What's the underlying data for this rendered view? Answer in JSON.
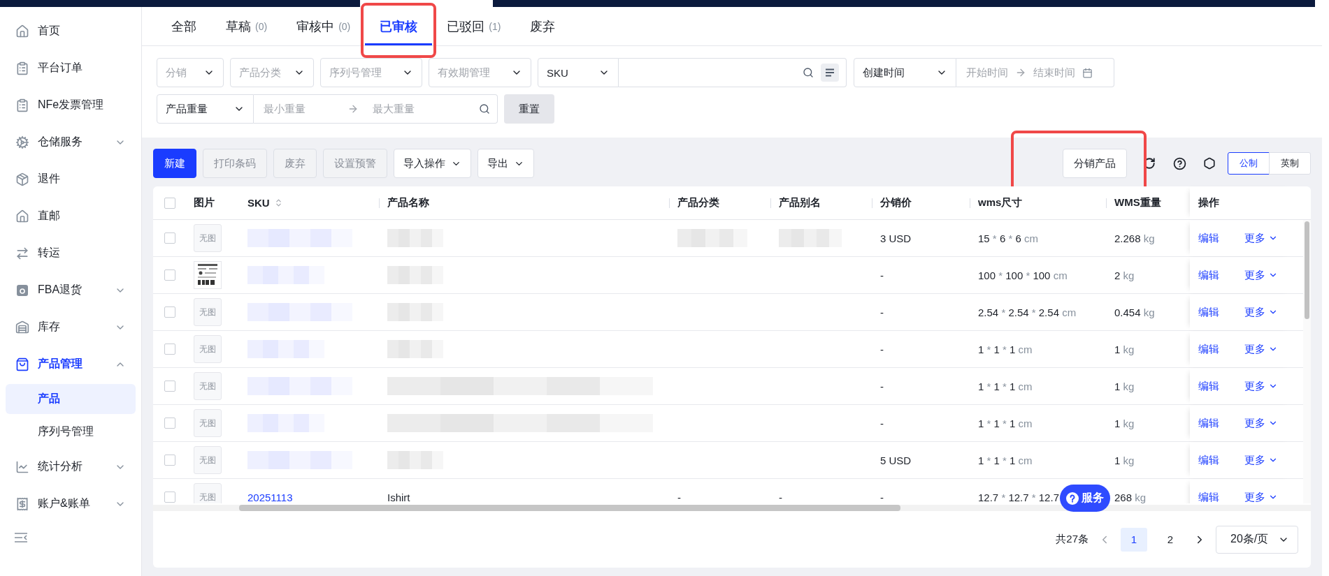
{
  "sidebar": {
    "items": [
      {
        "label": "首页",
        "selected": false
      },
      {
        "label": "平台订单",
        "selected": false
      },
      {
        "label": "NFe发票管理",
        "selected": false
      },
      {
        "label": "仓储服务",
        "selected": false,
        "expanded": false
      },
      {
        "label": "退件",
        "selected": false
      },
      {
        "label": "直邮",
        "selected": false
      },
      {
        "label": "转运",
        "selected": false
      },
      {
        "label": "FBA退货",
        "selected": false,
        "expanded": false
      },
      {
        "label": "库存",
        "selected": false,
        "expanded": false
      },
      {
        "label": "产品管理",
        "selected": true,
        "expanded": true,
        "children": [
          {
            "label": "产品",
            "selected": true
          },
          {
            "label": "序列号管理",
            "selected": false
          }
        ]
      },
      {
        "label": "统计分析",
        "selected": false,
        "expanded": false
      },
      {
        "label": "账户&账单",
        "selected": false,
        "expanded": false
      }
    ]
  },
  "tabs": [
    {
      "label": "全部",
      "selected": false
    },
    {
      "label": "草稿",
      "count": "(0)",
      "selected": false
    },
    {
      "label": "审核中",
      "count": "(0)",
      "selected": false
    },
    {
      "label": "已审核",
      "selected": true,
      "highlighted": true
    },
    {
      "label": "已驳回",
      "count": "(1)",
      "selected": false
    },
    {
      "label": "废弃",
      "selected": false
    }
  ],
  "filters": {
    "selects": [
      {
        "placeholder": "分销"
      },
      {
        "placeholder": "产品分类"
      },
      {
        "placeholder": "序列号管理"
      },
      {
        "placeholder": "有效期管理"
      }
    ],
    "sku_search": {
      "field": "SKU"
    },
    "date_range": {
      "field": "创建时间",
      "start_placeholder": "开始时间",
      "end_placeholder": "结束时间"
    },
    "weight_range": {
      "field": "产品重量",
      "min_placeholder": "最小重量",
      "max_placeholder": "最大重量"
    },
    "reset_button": "重置"
  },
  "toolbar": {
    "left": [
      {
        "label": "新建",
        "kind": "primary",
        "disabled": false
      },
      {
        "label": "打印条码",
        "kind": "plain",
        "disabled": true
      },
      {
        "label": "废弃",
        "kind": "plain",
        "disabled": true
      },
      {
        "label": "设置预警",
        "kind": "plain",
        "disabled": true
      },
      {
        "label": "导入操作",
        "kind": "dropdown",
        "disabled": false
      },
      {
        "label": "导出",
        "kind": "dropdown",
        "disabled": false
      }
    ],
    "distribute_button": {
      "label": "分销产品",
      "highlighted": true
    },
    "units": [
      {
        "label": "公制",
        "selected": true
      },
      {
        "label": "英制",
        "selected": false
      }
    ]
  },
  "table": {
    "header_checked": false,
    "columns": [
      "图片",
      "SKU",
      "产品名称",
      "产品分类",
      "产品别名",
      "分销价",
      "wms尺寸",
      "WMS重量",
      "操作"
    ],
    "rows": [
      {
        "checked": false,
        "image": {
          "kind": "none",
          "text": "无图"
        },
        "sku": {
          "kind": "blurred"
        },
        "name": {
          "kind": "blurred"
        },
        "category": {
          "kind": "blurred"
        },
        "alias": {
          "kind": "blurred"
        },
        "price": "3 USD",
        "size": "15 * 6 * 6 cm",
        "weight": "2.268 kg",
        "edit": "编辑",
        "more": "更多"
      },
      {
        "checked": false,
        "sku": {
          "kind": "blurred"
        },
        "name": {
          "kind": "blurred"
        },
        "price": "-",
        "size": "100 * 100 * 100 cm",
        "weight": "2 kg",
        "edit": "编辑",
        "more": "更多"
      },
      {
        "checked": false,
        "image": {
          "kind": "none",
          "text": "无图"
        },
        "sku": {
          "kind": "blurred"
        },
        "name": {
          "kind": "blurred"
        },
        "price": "-",
        "size": "2.54 * 2.54 * 2.54 cm",
        "weight": "0.454 kg",
        "edit": "编辑",
        "more": "更多"
      },
      {
        "checked": false,
        "image": {
          "kind": "none",
          "text": "无图"
        },
        "sku": {
          "kind": "blurred"
        },
        "name": {
          "kind": "blurred"
        },
        "price": "-",
        "size": "1 * 1 * 1 cm",
        "weight": "1 kg",
        "edit": "编辑",
        "more": "更多"
      },
      {
        "checked": false,
        "image": {
          "kind": "none",
          "text": "无图"
        },
        "sku": {
          "kind": "blurred"
        },
        "name": {
          "kind": "blurred"
        },
        "price": "-",
        "size": "1 * 1 * 1 cm",
        "weight": "1 kg",
        "edit": "编辑",
        "more": "更多"
      },
      {
        "checked": false,
        "image": {
          "kind": "none",
          "text": "无图"
        },
        "sku": {
          "kind": "blurred"
        },
        "name": {
          "kind": "blurred"
        },
        "price": "-",
        "size": "1 * 1 * 1 cm",
        "weight": "1 kg",
        "edit": "编辑",
        "more": "更多"
      },
      {
        "checked": false,
        "image": {
          "kind": "none",
          "text": "无图"
        },
        "sku": {
          "kind": "blurred"
        },
        "name": {
          "kind": "blurred"
        },
        "price": "5 USD",
        "size": "1 * 1 * 1 cm",
        "weight": "1 kg",
        "edit": "编辑",
        "more": "更多"
      },
      {
        "checked": false,
        "image": {
          "kind": "none",
          "text": "无图"
        },
        "sku": {
          "kind": "text",
          "text": "20251113"
        },
        "name": {
          "kind": "text",
          "text": "Ishirt"
        },
        "category": {
          "kind": "text",
          "text": "-"
        },
        "alias": {
          "kind": "text",
          "text": "-"
        },
        "price": "-",
        "size": "12.7 * 12.7 * 12.7",
        "weight": "268 kg",
        "edit": "编辑",
        "more": "更多"
      }
    ]
  },
  "pagination": {
    "total": "共27条",
    "pages": [
      {
        "label": "1",
        "selected": true
      },
      {
        "label": "2",
        "selected": false
      }
    ],
    "page_size": "20条/页"
  },
  "service_button": {
    "label": "服务"
  }
}
